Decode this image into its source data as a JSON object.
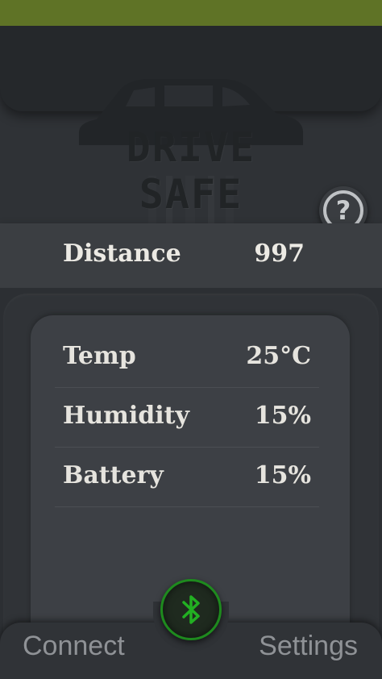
{
  "header": {
    "logo_text": "DRIVE SAFE",
    "help_label": "?"
  },
  "distance": {
    "label": "Distance",
    "value": "997"
  },
  "sensors": [
    {
      "label": "Temp",
      "value": "25°C"
    },
    {
      "label": "Humidity",
      "value": "15%"
    },
    {
      "label": "Battery",
      "value": "15%"
    }
  ],
  "nav": {
    "connect_label": "Connect",
    "settings_label": "Settings",
    "bluetooth_icon": "bluetooth-icon"
  },
  "colors": {
    "status_bar": "#5f7326",
    "bluetooth_accent": "#1e8a1e",
    "background": "#2a2d31"
  }
}
